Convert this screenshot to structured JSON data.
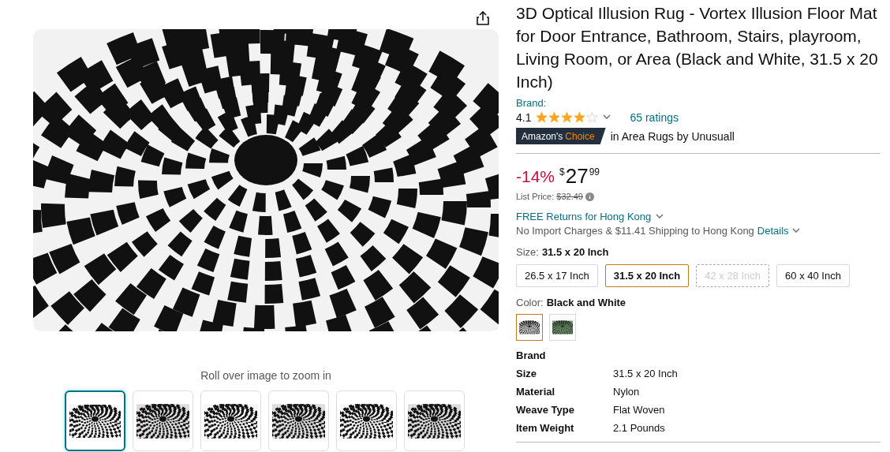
{
  "gallery": {
    "hint": "Roll over image to zoom in",
    "thumbnails": [
      {
        "selected": true
      },
      {
        "selected": false
      },
      {
        "selected": false
      },
      {
        "selected": false
      },
      {
        "selected": false
      },
      {
        "selected": false
      }
    ]
  },
  "product": {
    "title": "3D Optical Illusion Rug - Vortex Illusion Floor Mat for Door Entrance, Bathroom, Stairs, playroom, Living Room, or Area (Black and White, 31.5 x 20 Inch)",
    "brand_label": "Brand:",
    "rating": "4.1",
    "stars": 4,
    "ratings_count": "65 ratings",
    "badge_prefix": "Amazon's",
    "badge_highlight": "Choice",
    "badge_context": "in Area Rugs by Unusuall"
  },
  "price": {
    "discount": "-14%",
    "currency": "$",
    "whole": "27",
    "fraction": "99",
    "list_price_label": "List Price:",
    "list_price": "$32.49"
  },
  "delivery": {
    "returns": "FREE Returns for Hong Kong",
    "shipping": "No Import Charges & $11.41 Shipping to Hong Kong",
    "details_link": "Details"
  },
  "size": {
    "label": "Size:",
    "value": "31.5 x 20 Inch",
    "options": [
      {
        "label": "26.5 x 17 Inch",
        "selected": false,
        "disabled": false
      },
      {
        "label": "31.5 x 20 Inch",
        "selected": true,
        "disabled": false
      },
      {
        "label": "42 x 28 Inch",
        "selected": false,
        "disabled": true
      },
      {
        "label": "60 x 40 Inch",
        "selected": false,
        "disabled": false
      }
    ]
  },
  "color": {
    "label": "Color:",
    "value": "Black and White",
    "swatches": [
      {
        "kind": "checker",
        "selected": true
      },
      {
        "kind": "green",
        "selected": false
      }
    ]
  },
  "specs": [
    {
      "name": "Brand"
    },
    {
      "name": "Size",
      "value": "31.5 x 20 Inch"
    },
    {
      "name": "Material",
      "value": "Nylon"
    },
    {
      "name": "Weave Type",
      "value": "Flat Woven"
    },
    {
      "name": "Item Weight",
      "value": "2.1 Pounds"
    }
  ]
}
